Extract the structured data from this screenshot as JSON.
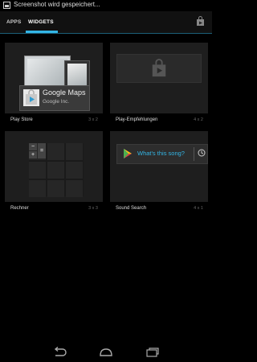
{
  "status_bar": {
    "notification_text": "Screenshot wird gespeichert..."
  },
  "tabs": [
    {
      "label": "APPS",
      "selected": false
    },
    {
      "label": "WIDGETS",
      "selected": true
    }
  ],
  "accent_color": "#33b5e5",
  "store_icon": "play-store-bag-icon",
  "widgets": [
    {
      "name": "Play Store",
      "span": "3 x 2",
      "preview": {
        "app_title": "Google Maps",
        "app_publisher": "Google Inc."
      }
    },
    {
      "name": "Play-Empfehlungen",
      "span": "4 x 2"
    },
    {
      "name": "Rechner",
      "span": "3 x 3",
      "preview": {
        "keys": [
          "−",
          "=",
          "+"
        ]
      }
    },
    {
      "name": "Sound Search",
      "span": "4 x 1",
      "preview": {
        "prompt": "What's this song?"
      }
    }
  ],
  "nav_bar": {
    "buttons": [
      "back-icon",
      "home-icon",
      "recent-apps-icon"
    ]
  }
}
